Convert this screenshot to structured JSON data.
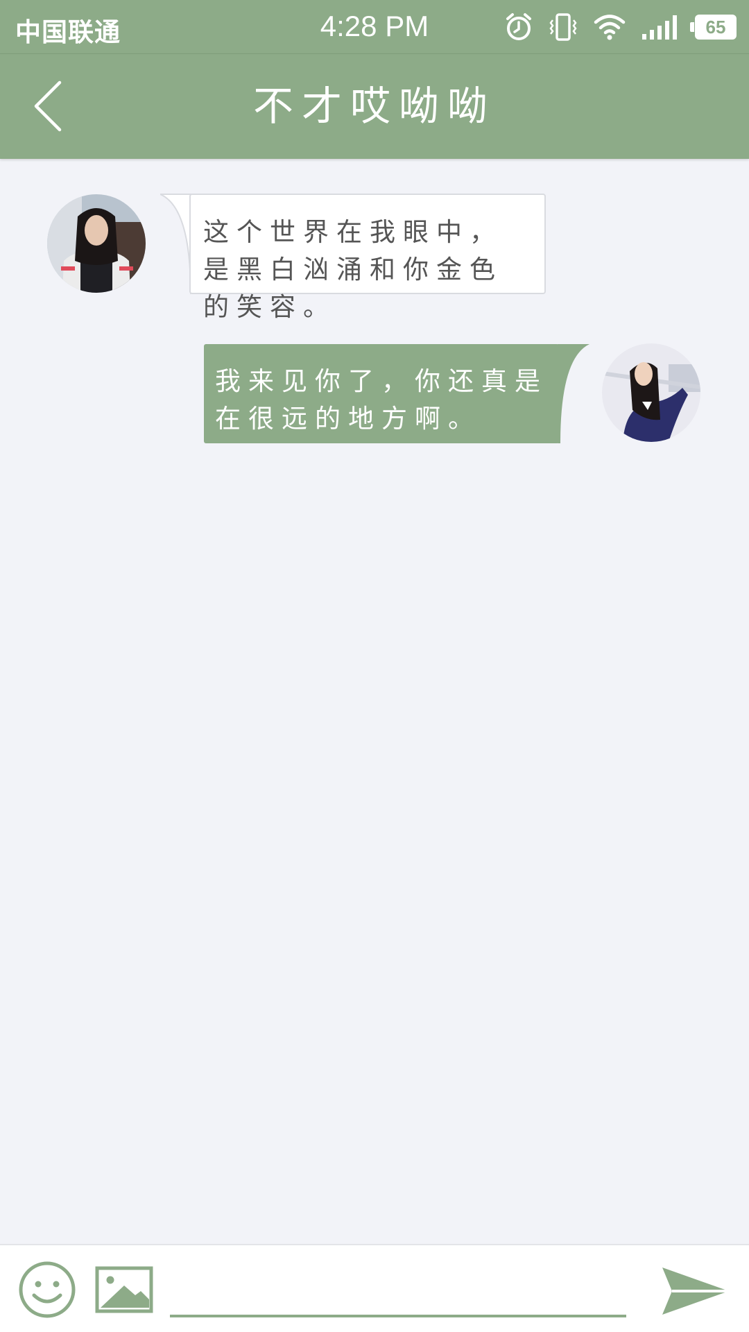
{
  "status_bar": {
    "carrier": "中国联通",
    "time": "4:28 PM",
    "battery": "65",
    "icons": [
      "alarm-icon",
      "vibrate-icon",
      "wifi-icon",
      "signal-icon",
      "battery-icon"
    ]
  },
  "header": {
    "title": "不才哎呦呦",
    "back_icon": "chevron-left-icon"
  },
  "messages": [
    {
      "side": "left",
      "text": "这个世界在我眼中，是黑白汹涌和你金色的笑容。",
      "avatar": "avatar-photo"
    },
    {
      "side": "right",
      "text": "我来见你了，你还真是在很远的地方啊。",
      "avatar": "avatar-photo"
    }
  ],
  "input_bar": {
    "message_value": "",
    "emoji_icon": "smiley-icon",
    "image_icon": "image-icon",
    "send_icon": "send-icon"
  },
  "colors": {
    "accent": "#8dab88",
    "background": "#f2f3f8",
    "bubble_incoming": "#ffffff",
    "bubble_outgoing": "#8dab88",
    "incoming_text": "#555555"
  }
}
